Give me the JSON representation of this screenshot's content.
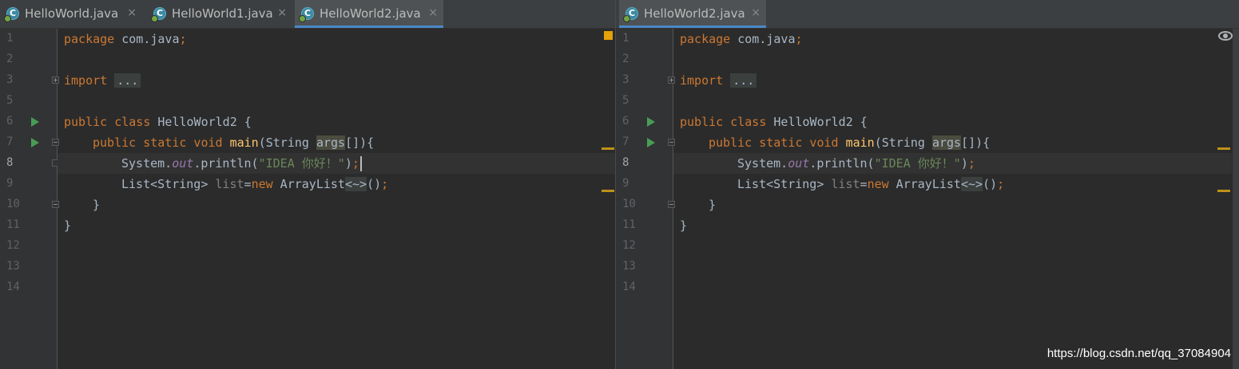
{
  "left_editor": {
    "tabs": [
      {
        "label": "HelloWorld.java",
        "close": "×",
        "icon": "java-class-icon"
      },
      {
        "label": "HelloWorld1.java",
        "close": "×",
        "icon": "java-class-icon"
      },
      {
        "label": "HelloWorld2.java",
        "close": "×",
        "icon": "java-class-icon",
        "active": true
      }
    ]
  },
  "right_editor": {
    "tabs": [
      {
        "label": "HelloWorld2.java",
        "close": "×",
        "icon": "java-class-icon",
        "active": true
      }
    ]
  },
  "line_numbers": [
    "1",
    "2",
    "3",
    "5",
    "6",
    "7",
    "8",
    "9",
    "10",
    "11",
    "12",
    "13",
    "14"
  ],
  "current_line": "8",
  "code": {
    "l1_kw": "package",
    "l1_rest": " com.java",
    "l1_semi": ";",
    "l3_kw": "import",
    "l3_fold": "...",
    "l6_kw": "public class",
    "l6_rest": " HelloWorld2 {",
    "l7_kw": "public static void",
    "l7_fn": "main",
    "l7_mid": "(String ",
    "l7_param": "args",
    "l7_end": "[]){",
    "l8_obj": "System.",
    "l8_field": "out",
    "l8_call": ".println(",
    "l8_str": "\"IDEA 你好！\"",
    "l8_end": ")",
    "l8_semi": ";",
    "l9_type": "List<String> ",
    "l9_var": "list",
    "l9_eq": "=",
    "l9_new": "new",
    "l9_cls": " ArrayList",
    "l9_diamond": "<~>",
    "l9_end": "()",
    "l9_semi": ";",
    "l10": "}",
    "l11": "}"
  },
  "colors": {
    "background": "#2b2b2b",
    "keyword": "#cc7832",
    "method": "#ffc66d",
    "string": "#6a8759",
    "field": "#9876aa",
    "text": "#a9b7c6",
    "tab_accent": "#4a88c7",
    "warning": "#e5a00b"
  },
  "watermark": "https://blog.csdn.net/qq_37084904"
}
